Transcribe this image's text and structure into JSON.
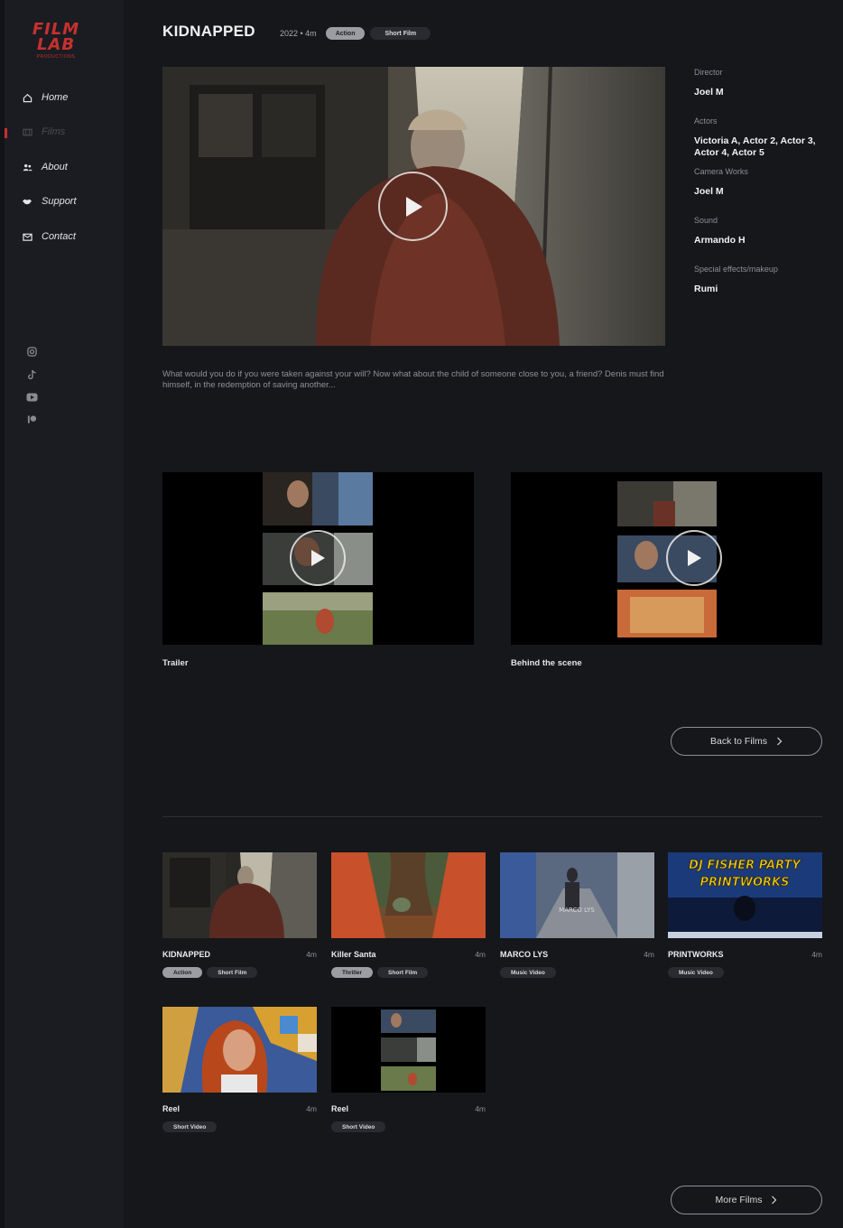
{
  "brand": {
    "line1": "FILM",
    "line2": "LAB",
    "line3": "PRODUCTIONS",
    "color": "#c6312f"
  },
  "nav": {
    "items": [
      {
        "label": "Home",
        "icon": "home-icon"
      },
      {
        "label": "Films",
        "icon": "film-icon",
        "active": true
      },
      {
        "label": "About",
        "icon": "people-icon"
      },
      {
        "label": "Support",
        "icon": "handshake-icon"
      },
      {
        "label": "Contact",
        "icon": "mail-icon"
      }
    ]
  },
  "social": [
    "instagram-icon",
    "tiktok-icon",
    "youtube-icon",
    "patreon-icon"
  ],
  "film": {
    "title": "KIDNAPPED",
    "meta": "2022 • 4m",
    "tags": [
      "Action",
      "Short Film"
    ],
    "description": "What would you do if you were taken against your will? Now what about the child of someone close to you, a friend? Denis must find himself, in the redemption of saving another..."
  },
  "credits": [
    {
      "label": "Director",
      "value": "Joel M"
    },
    {
      "label": "Actors",
      "value": "Victoria A, Actor 2, Actor 3, Actor 4, Actor 5"
    },
    {
      "label": "Camera Works",
      "value": "Joel M"
    },
    {
      "label": "Sound",
      "value": "Armando H"
    },
    {
      "label": "Special effects/makeup",
      "value": "Rumi"
    }
  ],
  "videos": [
    {
      "label": "Trailer"
    },
    {
      "label": "Behind the scene"
    }
  ],
  "back_button": "Back to Films",
  "films": [
    {
      "name": "KIDNAPPED",
      "duration": "4m",
      "tags": [
        {
          "text": "Action",
          "filled": true
        },
        {
          "text": "Short Film",
          "filled": false
        }
      ]
    },
    {
      "name": "Killer Santa",
      "duration": "4m",
      "tags": [
        {
          "text": "Thriller",
          "filled": true
        },
        {
          "text": "Short Film",
          "filled": false
        }
      ]
    },
    {
      "name": "MARCO LYS",
      "duration": "4m",
      "tags": [
        {
          "text": "Music Video",
          "filled": false
        }
      ]
    },
    {
      "name": "PRINTWORKS",
      "duration": "4m",
      "tags": [
        {
          "text": "Music Video",
          "filled": false
        }
      ]
    },
    {
      "name": "Reel",
      "duration": "4m",
      "tags": [
        {
          "text": "Short Video",
          "filled": false
        }
      ]
    },
    {
      "name": "Reel",
      "duration": "4m",
      "tags": [
        {
          "text": "Short Video",
          "filled": false
        }
      ]
    }
  ],
  "thumb_texts": {
    "marco": "MARCO LYS",
    "dj1": "DJ FISHER PARTY",
    "dj2": "PRINTWORKS"
  },
  "more_button": "More Films"
}
